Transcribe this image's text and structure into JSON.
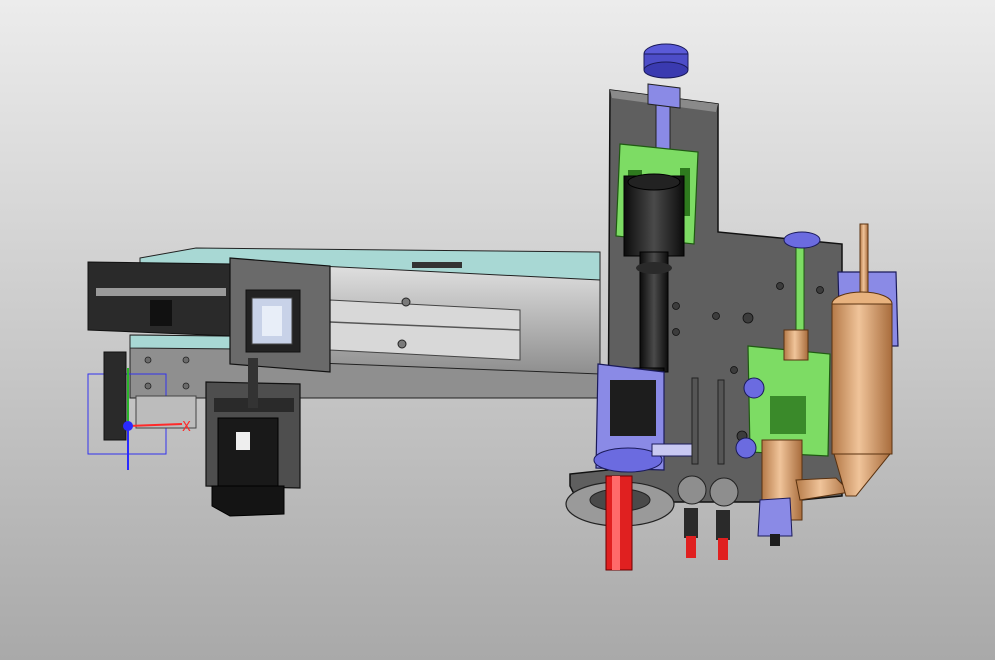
{
  "viewport": {
    "background_top": "#ececec",
    "background_bottom": "#a9a9a9"
  },
  "colors": {
    "plate": "#5f5f5f",
    "plate_dark": "#3c3c3c",
    "rail": "#b3b3b3",
    "rail_light": "#d6d6d6",
    "base_teal": "#a8d8d4",
    "green_part": "#7ddc64",
    "blue_part": "#8a8ae6",
    "copper_part": "#d99d6a",
    "red_rod": "#e02020",
    "black_part": "#1d1d1d"
  },
  "triad": {
    "x_label": "X",
    "x_color": "#ff2a2a",
    "y_color": "#2ab52a",
    "z_color": "#2a2aff"
  }
}
